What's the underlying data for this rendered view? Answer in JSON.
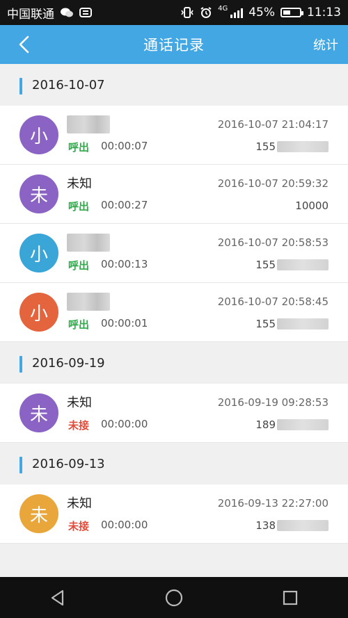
{
  "status_bar": {
    "carrier": "中国联通",
    "network": "4G",
    "battery_text": "45%",
    "battery_level": 0.45,
    "time": "11:13"
  },
  "app_bar": {
    "title": "通话记录",
    "stats_label": "统计"
  },
  "groups": [
    {
      "date": "2016-10-07",
      "records": [
        {
          "avatar_char": "小",
          "avatar_color": "#8a63c4",
          "name": "",
          "call_type": "呼出",
          "call_type_color": "#2fa94a",
          "duration": "00:00:07",
          "datetime": "2016-10-07 21:04:17",
          "number_prefix": "155"
        },
        {
          "avatar_char": "未",
          "avatar_color": "#8a63c4",
          "name": "未知",
          "call_type": "呼出",
          "call_type_color": "#2fa94a",
          "duration": "00:00:27",
          "datetime": "2016-10-07 20:59:32",
          "number_prefix": "10000"
        },
        {
          "avatar_char": "小",
          "avatar_color": "#3aa6d8",
          "name": "",
          "call_type": "呼出",
          "call_type_color": "#2fa94a",
          "duration": "00:00:13",
          "datetime": "2016-10-07 20:58:53",
          "number_prefix": "155"
        },
        {
          "avatar_char": "小",
          "avatar_color": "#e4643d",
          "name": "",
          "call_type": "呼出",
          "call_type_color": "#2fa94a",
          "duration": "00:00:01",
          "datetime": "2016-10-07 20:58:45",
          "number_prefix": "155"
        }
      ]
    },
    {
      "date": "2016-09-19",
      "records": [
        {
          "avatar_char": "未",
          "avatar_color": "#8a63c4",
          "name": "未知",
          "call_type": "未接",
          "call_type_color": "#e14b3a",
          "duration": "00:00:00",
          "datetime": "2016-09-19 09:28:53",
          "number_prefix": "189"
        }
      ]
    },
    {
      "date": "2016-09-13",
      "records": [
        {
          "avatar_char": "未",
          "avatar_color": "#e9a63a",
          "name": "未知",
          "call_type": "未接",
          "call_type_color": "#e14b3a",
          "duration": "00:00:00",
          "datetime": "2016-09-13 22:27:00",
          "number_prefix": "138"
        }
      ]
    }
  ],
  "colors": {
    "accent": "#42a7e3",
    "outgoing": "#2fa94a",
    "missed": "#e14b3a"
  }
}
